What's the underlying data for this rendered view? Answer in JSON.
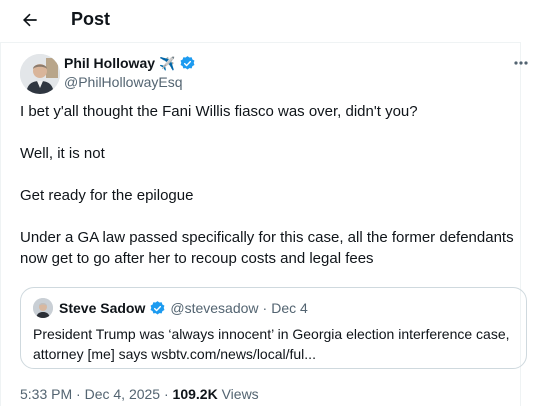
{
  "header": {
    "title": "Post"
  },
  "author": {
    "name": "Phil Holloway",
    "emoji": "✈️",
    "handle": "@PhilHollowayEsq"
  },
  "post": {
    "lines": [
      "I bet y'all thought the Fani Willis fiasco was over, didn't you?",
      "Well, it is not",
      "Get ready for the epilogue",
      "Under a GA law passed specifically for this case, all the former defendants now get to go after her to recoup costs and legal fees"
    ]
  },
  "quote": {
    "name": "Steve Sadow",
    "handle": "@stevesadow",
    "separator": "·",
    "date": "Dec 4",
    "text": "President Trump was ‘always innocent’ in Georgia election interference case, attorney [me] says wsbtv.com/news/local/ful..."
  },
  "footer": {
    "time": "5:33 PM",
    "separator": "·",
    "date": "Dec 4, 2025",
    "separator2": "·",
    "views_count": "109.2K",
    "views_label": "Views"
  },
  "colors": {
    "verified": "#1d9bf0",
    "text": "#0f1419",
    "muted": "#536471"
  },
  "icons": {
    "back": "arrow-left-icon",
    "more": "more-horizontal-icon",
    "verified": "verified-badge-icon"
  }
}
